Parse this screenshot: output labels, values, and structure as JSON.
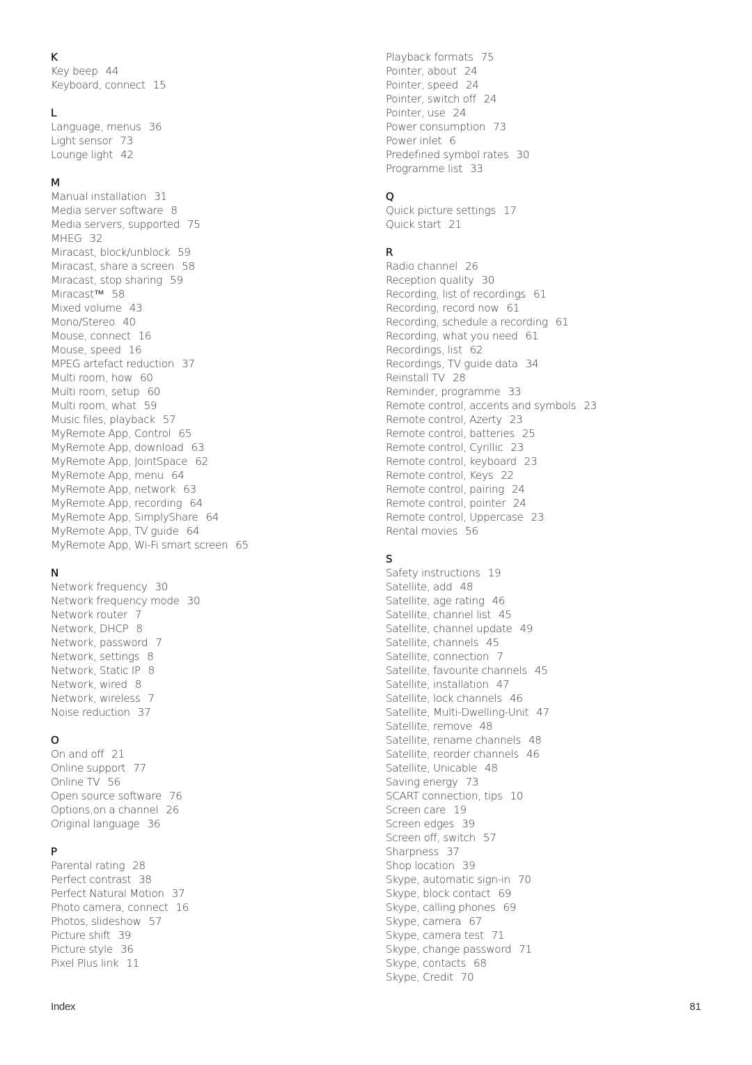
{
  "left_column": [
    {
      "letter": "K",
      "entries": [
        {
          "term": "Key beep",
          "page": "44"
        },
        {
          "term": "Keyboard, connect",
          "page": "15"
        }
      ]
    },
    {
      "letter": "L",
      "entries": [
        {
          "term": "Language, menus",
          "page": "36"
        },
        {
          "term": "Light sensor",
          "page": "73"
        },
        {
          "term": "Lounge light",
          "page": "42"
        }
      ]
    },
    {
      "letter": "M",
      "entries": [
        {
          "term": "Manual installation",
          "page": "31"
        },
        {
          "term": "Media server software",
          "page": "8"
        },
        {
          "term": "Media servers, supported",
          "page": "75"
        },
        {
          "term": "MHEG",
          "page": "32"
        },
        {
          "term": "Miracast, block/unblock",
          "page": "59"
        },
        {
          "term": "Miracast, share a screen",
          "page": "58"
        },
        {
          "term": "Miracast, stop sharing",
          "page": "59"
        },
        {
          "term": "Miracast™",
          "page": "58"
        },
        {
          "term": "Mixed volume",
          "page": "43"
        },
        {
          "term": "Mono/Stereo",
          "page": "40"
        },
        {
          "term": "Mouse, connect",
          "page": "16"
        },
        {
          "term": "Mouse, speed",
          "page": "16"
        },
        {
          "term": "MPEG artefact reduction",
          "page": "37"
        },
        {
          "term": "Multi room, how",
          "page": "60"
        },
        {
          "term": "Multi room, setup",
          "page": "60"
        },
        {
          "term": "Multi room, what",
          "page": "59"
        },
        {
          "term": "Music files, playback",
          "page": "57"
        },
        {
          "term": "MyRemote App, Control",
          "page": "65"
        },
        {
          "term": "MyRemote App, download",
          "page": "63"
        },
        {
          "term": "MyRemote App, JointSpace",
          "page": "62"
        },
        {
          "term": "MyRemote App, menu",
          "page": "64"
        },
        {
          "term": "MyRemote App, network",
          "page": "63"
        },
        {
          "term": "MyRemote App, recording",
          "page": "64"
        },
        {
          "term": "MyRemote App, SimplyShare",
          "page": "64"
        },
        {
          "term": "MyRemote App, TV guide",
          "page": "64"
        },
        {
          "term": "MyRemote App, Wi-Fi smart screen",
          "page": "65"
        }
      ]
    },
    {
      "letter": "N",
      "entries": [
        {
          "term": "Network frequency",
          "page": "30"
        },
        {
          "term": "Network frequency mode",
          "page": "30"
        },
        {
          "term": "Network router",
          "page": "7"
        },
        {
          "term": "Network, DHCP",
          "page": "8"
        },
        {
          "term": "Network, password",
          "page": "7"
        },
        {
          "term": "Network, settings",
          "page": "8"
        },
        {
          "term": "Network, Static IP",
          "page": "8"
        },
        {
          "term": "Network, wired",
          "page": "8"
        },
        {
          "term": "Network, wireless",
          "page": "7"
        },
        {
          "term": "Noise reduction",
          "page": "37"
        }
      ]
    },
    {
      "letter": "O",
      "entries": [
        {
          "term": "On and off",
          "page": "21"
        },
        {
          "term": "Online support",
          "page": "77"
        },
        {
          "term": "Online TV",
          "page": "56"
        },
        {
          "term": "Open source software",
          "page": "76"
        },
        {
          "term": "Options,on a channel",
          "page": "26"
        },
        {
          "term": "Original language",
          "page": "36"
        }
      ]
    },
    {
      "letter": "P",
      "entries": [
        {
          "term": "Parental rating",
          "page": "28"
        },
        {
          "term": "Perfect contrast",
          "page": "38"
        },
        {
          "term": "Perfect Natural Motion",
          "page": "37"
        },
        {
          "term": "Photo camera, connect",
          "page": "16"
        },
        {
          "term": "Photos, slideshow",
          "page": "57"
        },
        {
          "term": "Picture shift",
          "page": "39"
        },
        {
          "term": "Picture style",
          "page": "36"
        },
        {
          "term": "Pixel Plus link",
          "page": "11"
        }
      ]
    }
  ],
  "right_column": [
    {
      "letter": "",
      "entries": [
        {
          "term": "Playback formats",
          "page": "75"
        },
        {
          "term": "Pointer, about",
          "page": "24"
        },
        {
          "term": "Pointer, speed",
          "page": "24"
        },
        {
          "term": "Pointer, switch off",
          "page": "24"
        },
        {
          "term": "Pointer, use",
          "page": "24"
        },
        {
          "term": "Power consumption",
          "page": "73"
        },
        {
          "term": "Power inlet",
          "page": "6"
        },
        {
          "term": "Predefined symbol rates",
          "page": "30"
        },
        {
          "term": "Programme list",
          "page": "33"
        }
      ]
    },
    {
      "letter": "Q",
      "entries": [
        {
          "term": "Quick picture settings",
          "page": "17"
        },
        {
          "term": "Quick start",
          "page": "21"
        }
      ]
    },
    {
      "letter": "R",
      "entries": [
        {
          "term": "Radio channel",
          "page": "26"
        },
        {
          "term": "Reception quality",
          "page": "30"
        },
        {
          "term": "Recording, list of recordings",
          "page": "61"
        },
        {
          "term": "Recording, record now",
          "page": "61"
        },
        {
          "term": "Recording, schedule a recording",
          "page": "61"
        },
        {
          "term": "Recording, what you need",
          "page": "61"
        },
        {
          "term": "Recordings, list",
          "page": "62"
        },
        {
          "term": "Recordings, TV guide data",
          "page": "34"
        },
        {
          "term": "Reinstall TV",
          "page": "28"
        },
        {
          "term": "Reminder, programme",
          "page": "33"
        },
        {
          "term": "Remote control, accents and symbols",
          "page": "23"
        },
        {
          "term": "Remote control, Azerty",
          "page": "23"
        },
        {
          "term": "Remote control, batteries",
          "page": "25"
        },
        {
          "term": "Remote control, Cyrillic",
          "page": "23"
        },
        {
          "term": "Remote control, keyboard",
          "page": "23"
        },
        {
          "term": "Remote control, Keys",
          "page": "22"
        },
        {
          "term": "Remote control, pairing",
          "page": "24"
        },
        {
          "term": "Remote control, pointer",
          "page": "24"
        },
        {
          "term": "Remote control, Uppercase",
          "page": "23"
        },
        {
          "term": "Rental movies",
          "page": "56"
        }
      ]
    },
    {
      "letter": "S",
      "entries": [
        {
          "term": "Safety instructions",
          "page": "19"
        },
        {
          "term": "Satellite, add",
          "page": "48"
        },
        {
          "term": "Satellite, age rating",
          "page": "46"
        },
        {
          "term": "Satellite, channel list",
          "page": "45"
        },
        {
          "term": "Satellite, channel update",
          "page": "49"
        },
        {
          "term": "Satellite, channels",
          "page": "45"
        },
        {
          "term": "Satellite, connection",
          "page": "7"
        },
        {
          "term": "Satellite, favourite channels",
          "page": "45"
        },
        {
          "term": "Satellite, installation",
          "page": "47"
        },
        {
          "term": "Satellite, lock channels",
          "page": "46"
        },
        {
          "term": "Satellite, Multi-Dwelling-Unit",
          "page": "47"
        },
        {
          "term": "Satellite, remove",
          "page": "48"
        },
        {
          "term": "Satellite, rename channels",
          "page": "48"
        },
        {
          "term": "Satellite, reorder channels",
          "page": "46"
        },
        {
          "term": "Satellite, Unicable",
          "page": "48"
        },
        {
          "term": "Saving energy",
          "page": "73"
        },
        {
          "term": "SCART connection, tips",
          "page": "10"
        },
        {
          "term": "Screen care",
          "page": "19"
        },
        {
          "term": "Screen edges",
          "page": "39"
        },
        {
          "term": "Screen off, switch",
          "page": "57"
        },
        {
          "term": "Sharpness",
          "page": "37"
        },
        {
          "term": "Shop location",
          "page": "39"
        },
        {
          "term": "Skype, automatic sign-in",
          "page": "70"
        },
        {
          "term": "Skype, block contact",
          "page": "69"
        },
        {
          "term": "Skype, calling phones",
          "page": "69"
        },
        {
          "term": "Skype, camera",
          "page": "67"
        },
        {
          "term": "Skype, camera test",
          "page": "71"
        },
        {
          "term": "Skype, change password",
          "page": "71"
        },
        {
          "term": "Skype, contacts",
          "page": "68"
        },
        {
          "term": "Skype, Credit",
          "page": "70"
        }
      ]
    }
  ],
  "footer": {
    "section_label": "Index",
    "page_number": "81"
  }
}
